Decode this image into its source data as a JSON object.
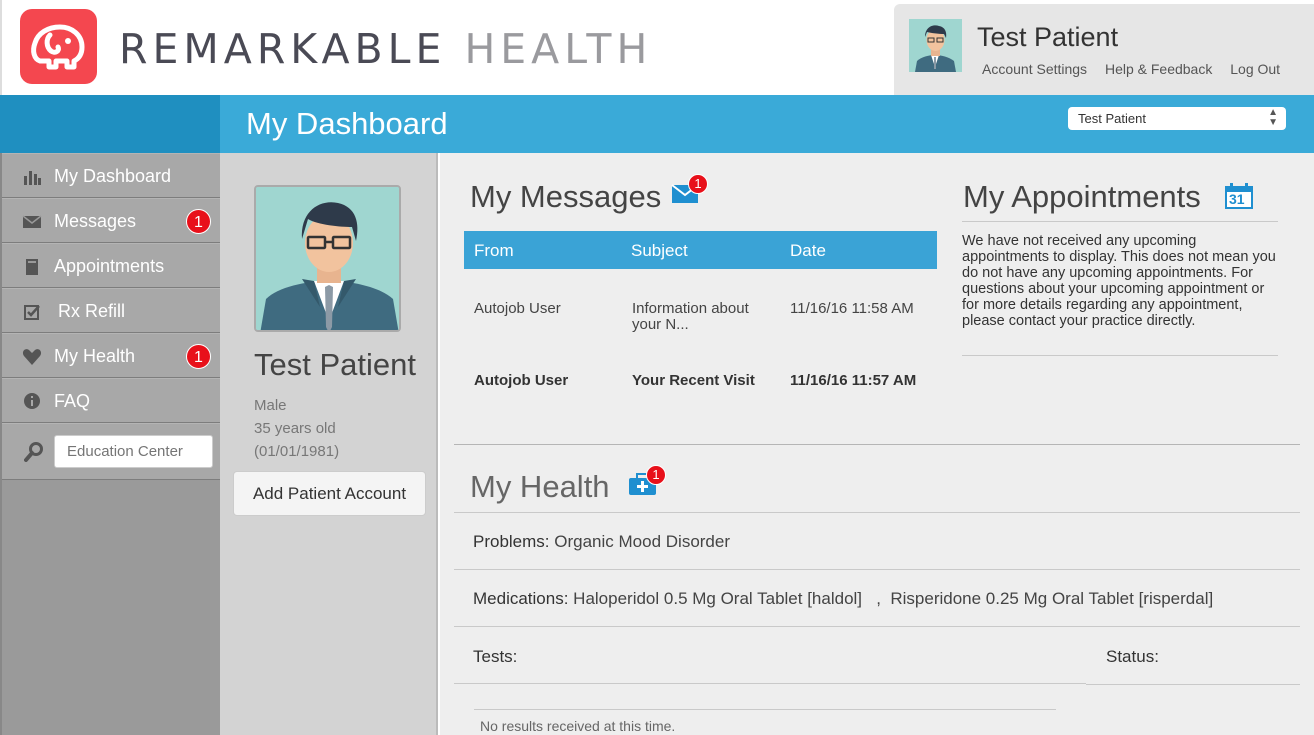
{
  "brand": {
    "name_part1": "REMARKABLE",
    "name_part2": "HEALTH",
    "color": "#f4474f"
  },
  "user": {
    "name": "Test Patient",
    "links": [
      "Account Settings",
      "Help & Feedback",
      "Log Out"
    ]
  },
  "header": {
    "title": "My Dashboard",
    "patient_select": "Test Patient"
  },
  "sidebar": {
    "items": [
      {
        "label": "My Dashboard",
        "icon": "bar-chart-icon"
      },
      {
        "label": "Messages",
        "icon": "envelope-icon",
        "badge": "1"
      },
      {
        "label": "Appointments",
        "icon": "book-icon"
      },
      {
        "label": "Rx Refill",
        "icon": "checkbox-icon"
      },
      {
        "label": "My Health",
        "icon": "heart-icon",
        "badge": "1"
      },
      {
        "label": "FAQ",
        "icon": "info-icon"
      }
    ],
    "search_placeholder": "Education Center"
  },
  "profile": {
    "name": "Test Patient",
    "gender": "Male",
    "age": "35 years old",
    "dob": "(01/01/1981)",
    "add_button": "Add Patient Account"
  },
  "messages": {
    "title": "My Messages",
    "badge": "1",
    "columns": [
      "From",
      "Subject",
      "Date"
    ],
    "rows": [
      {
        "from": "Autojob User",
        "subject": "Information about your N...",
        "date": "11/16/16 11:58 AM",
        "unread": false
      },
      {
        "from": "Autojob User",
        "subject": "Your Recent Visit",
        "date": "11/16/16 11:57 AM",
        "unread": true
      }
    ]
  },
  "appointments": {
    "title": "My Appointments",
    "calendar_day": "31",
    "text": "We have not received any upcoming appointments to display. This does not mean you do not have any upcoming appointments. For questions about your upcoming appointment or for more details regarding any appointment, please contact your practice directly."
  },
  "health": {
    "title": "My Health",
    "badge": "1",
    "problems_label": "Problems:",
    "problems_value": "Organic Mood Disorder",
    "medications_label": "Medications:",
    "medications_value": "Haloperidol 0.5 Mg Oral Tablet [haldol]   ,  Risperidone 0.25 Mg Oral Tablet [risperdal]",
    "tests_label": "Tests:",
    "status_label": "Status:",
    "no_results": "No results received at this time."
  }
}
